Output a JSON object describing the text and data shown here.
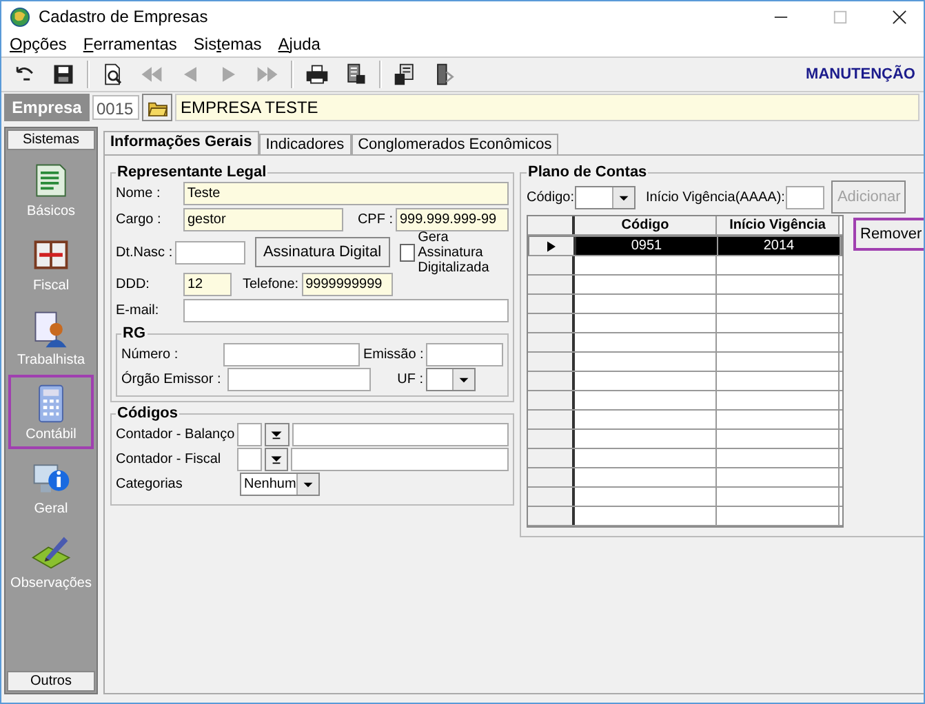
{
  "window": {
    "title": "Cadastro de Empresas"
  },
  "menu": [
    {
      "key": "O",
      "post": "pções"
    },
    {
      "key": "F",
      "post": "erramentas"
    },
    {
      "pre": "Sis",
      "key": "t",
      "post": "emas"
    },
    {
      "key": "A",
      "post": "juda"
    }
  ],
  "toolbar": {
    "buttons": [
      {
        "kind": "undo",
        "disabled": false
      },
      {
        "kind": "save",
        "disabled": false
      },
      {
        "kind": "sep"
      },
      {
        "kind": "preview",
        "disabled": false
      },
      {
        "kind": "first",
        "disabled": true
      },
      {
        "kind": "prev",
        "disabled": true
      },
      {
        "kind": "next",
        "disabled": true
      },
      {
        "kind": "last",
        "disabled": true
      },
      {
        "kind": "sep"
      },
      {
        "kind": "print",
        "disabled": false
      },
      {
        "kind": "report",
        "disabled": false
      },
      {
        "kind": "sep"
      },
      {
        "kind": "tool",
        "disabled": false
      },
      {
        "kind": "exit",
        "disabled": false
      }
    ],
    "mode": "MANUTENÇÃO"
  },
  "empresa": {
    "label": "Empresa",
    "code": "0015",
    "name": "EMPRESA TESTE"
  },
  "sidebar": {
    "header": "Sistemas",
    "items": [
      {
        "kind": "book",
        "label": "Básicos",
        "highlighted": false
      },
      {
        "kind": "fiscal",
        "label": "Fiscal",
        "highlighted": false
      },
      {
        "kind": "person",
        "label": "Trabalhista",
        "highlighted": false
      },
      {
        "kind": "calc",
        "label": "Contábil",
        "highlighted": true
      },
      {
        "kind": "info",
        "label": "Geral",
        "highlighted": false
      },
      {
        "kind": "pencil",
        "label": "Observações",
        "highlighted": false
      }
    ],
    "footer": "Outros"
  },
  "tabs": [
    {
      "label": "Informações Gerais",
      "selected": true
    },
    {
      "label": "Indicadores",
      "selected": false
    },
    {
      "label": "Conglomerados Econômicos",
      "selected": false
    }
  ],
  "representante": {
    "title": "Representante Legal",
    "nome_label": "Nome :",
    "nome": "Teste",
    "cargo_label": "Cargo :",
    "cargo": "gestor",
    "cpf_label": "CPF :",
    "cpf": "999.999.999-99",
    "nasc_label": "Dt.Nasc :",
    "assinatura_button": "Assinatura Digital",
    "gera_label": "Gera Assinatura Digitalizada",
    "gera_checked": false,
    "ddd_label": "DDD:",
    "ddd": "12",
    "telefone_label": "Telefone:",
    "telefone": "9999999999",
    "email_label": "E-mail:",
    "rg": {
      "title": "RG",
      "numero_label": "Número :",
      "emissao_label": "Emissão :",
      "orgao_label": "Órgão Emissor :",
      "uf_label": "UF :"
    }
  },
  "codigos": {
    "title": "Códigos",
    "balanco_label": "Contador - Balanço",
    "fiscal_label": "Contador - Fiscal",
    "categorias_label": "Categorias",
    "categoria": "Nenhum"
  },
  "plano": {
    "title": "Plano de Contas",
    "codigo_label": "Código:",
    "inicio_label": "Início Vigência(AAAA):",
    "adicionar": {
      "label": "Adicionar",
      "disabled": true,
      "highlighted": false
    },
    "remover": {
      "label": "Remover",
      "disabled": false,
      "highlighted": true
    },
    "columns": [
      "Código",
      "Início Vigência"
    ],
    "rows": [
      {
        "cells": [
          "0951",
          "2014"
        ],
        "selected": true
      }
    ]
  }
}
